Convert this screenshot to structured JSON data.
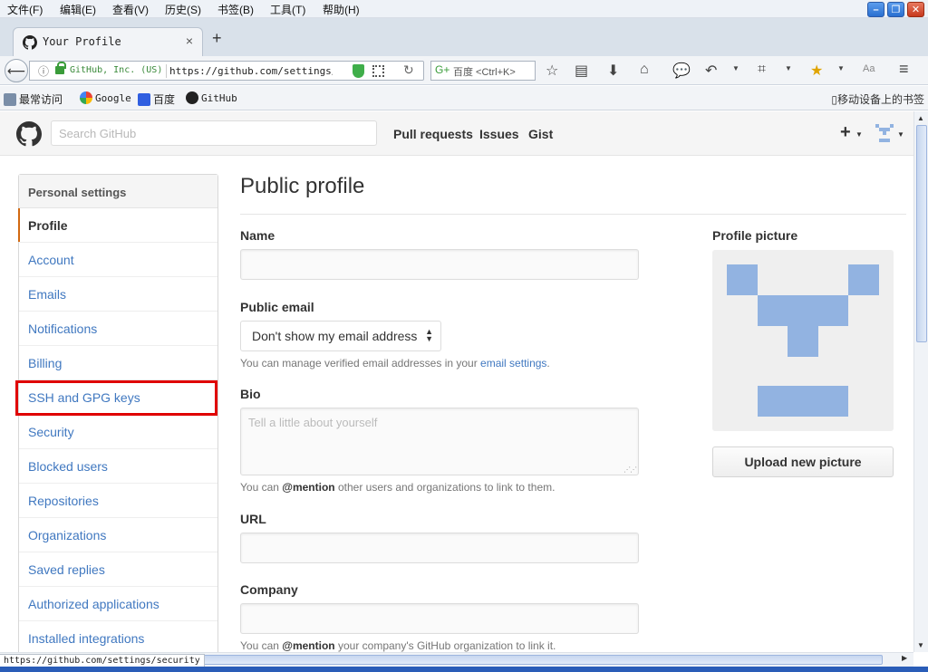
{
  "menubar": {
    "items": [
      "文件(F)",
      "编辑(E)",
      "查看(V)",
      "历史(S)",
      "书签(B)",
      "工具(T)",
      "帮助(H)"
    ]
  },
  "tab": {
    "title": "Your Profile"
  },
  "navbar": {
    "identity": "GitHub, Inc. (US)",
    "url": "https://github.com/settings/profile",
    "search_placeholder": "百度 <Ctrl+K>"
  },
  "bookmarks": {
    "items": [
      "最常访问",
      "Google",
      "百度",
      "GitHub"
    ],
    "mobile": "移动设备上的书签"
  },
  "github": {
    "search_placeholder": "Search GitHub",
    "nav": [
      "Pull requests",
      "Issues",
      "Gist"
    ],
    "plus": "+"
  },
  "sidebar": {
    "heading": "Personal settings",
    "items": [
      "Profile",
      "Account",
      "Emails",
      "Notifications",
      "Billing",
      "SSH and GPG keys",
      "Security",
      "Blocked users",
      "Repositories",
      "Organizations",
      "Saved replies",
      "Authorized applications",
      "Installed integrations"
    ],
    "selected": "Profile"
  },
  "profile": {
    "title": "Public profile",
    "name_label": "Name",
    "name_value": "",
    "email_label": "Public email",
    "email_selected": "Don't show my email address",
    "email_note_prefix": "You can manage verified email addresses in your ",
    "email_note_link": "email settings",
    "email_note_suffix": ".",
    "bio_label": "Bio",
    "bio_placeholder": "Tell a little about yourself",
    "bio_note_prefix": "You can ",
    "bio_note_mention": "@mention",
    "bio_note_suffix": " other users and organizations to link to them.",
    "url_label": "URL",
    "url_value": "",
    "company_label": "Company",
    "company_value": "",
    "company_note_prefix": "You can ",
    "company_note_mention": "@mention",
    "company_note_suffix": " your company's GitHub organization to link it.",
    "picture_label": "Profile picture",
    "upload_label": "Upload new picture"
  },
  "status": {
    "text": "https://github.com/settings/security"
  },
  "colors": {
    "link": "#4078c0",
    "selected_accent": "#d26911",
    "highlight_box": "#e00000",
    "identicon": "#92b3e1"
  }
}
